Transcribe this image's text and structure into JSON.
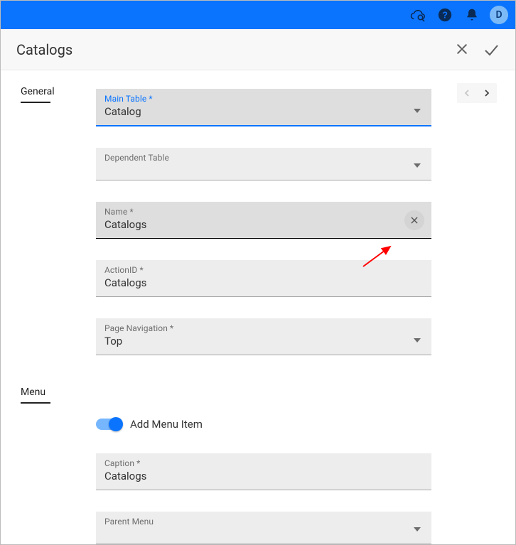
{
  "topbar": {
    "avatar_initial": "D"
  },
  "header": {
    "title": "Catalogs"
  },
  "sections": {
    "general_label": "General",
    "menu_label": "Menu"
  },
  "fields": {
    "main_table": {
      "label": "Main Table *",
      "value": "Catalog"
    },
    "dependent_table": {
      "label": "Dependent Table",
      "value": ""
    },
    "name": {
      "label": "Name *",
      "value": "Catalogs"
    },
    "action_id": {
      "label": "ActionID *",
      "value": "Catalogs"
    },
    "page_nav": {
      "label": "Page Navigation *",
      "value": "Top"
    },
    "caption": {
      "label": "Caption *",
      "value": "Catalogs"
    },
    "parent_menu": {
      "label": "Parent Menu",
      "value": ""
    }
  },
  "menu": {
    "add_menu_item_label": "Add Menu Item",
    "add_menu_item_on": true
  }
}
